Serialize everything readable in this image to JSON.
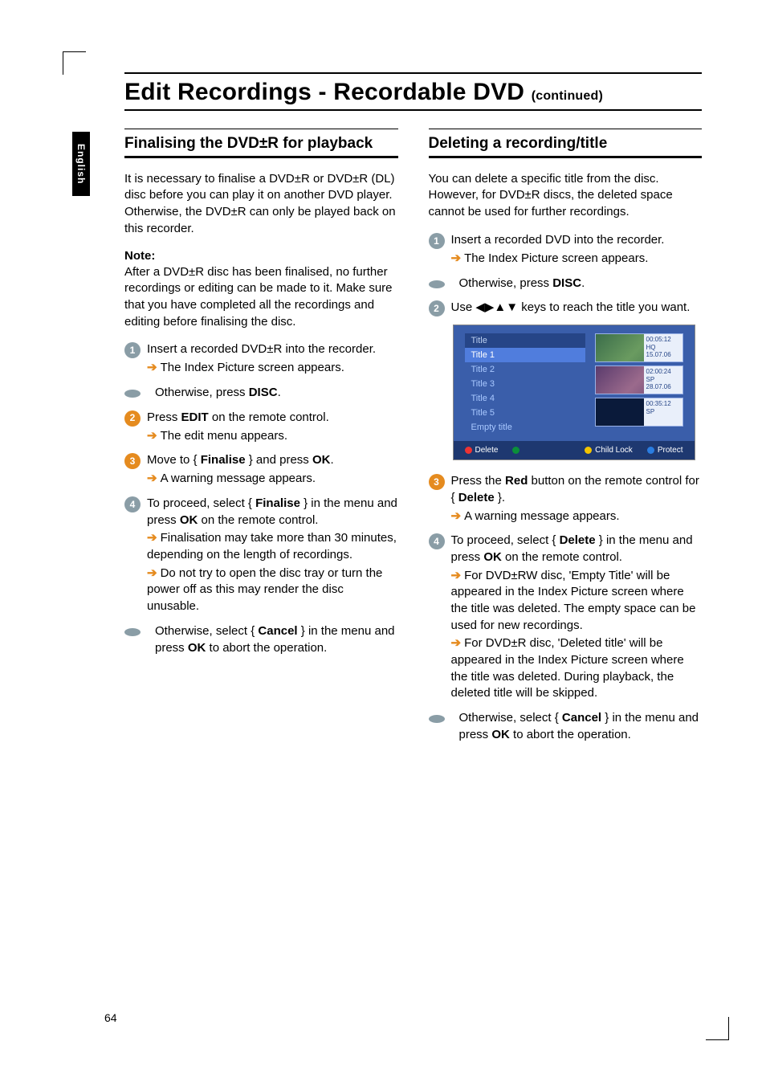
{
  "side_tab": "English",
  "main_title": "Edit Recordings - Recordable DVD",
  "main_title_cont": "(continued)",
  "left": {
    "heading": "Finalising the DVD±R for playback",
    "intro": "It is necessary to finalise a DVD±R or DVD±R (DL) disc before you can play it on another DVD player. Otherwise, the DVD±R can only be played back on this recorder.",
    "note_label": "Note:",
    "note_body": "After a DVD±R disc has been finalised, no further recordings or editing can be made to it. Make sure that you have completed all the recordings and editing before finalising the disc.",
    "step1": "Insert a recorded DVD±R into the recorder.",
    "step1_arrow": "The Index Picture screen appears.",
    "alt1_pre": "Otherwise, press ",
    "alt1_bold": "DISC",
    "alt1_post": ".",
    "step2_pre": "Press ",
    "step2_bold": "EDIT",
    "step2_post": " on the remote control.",
    "step2_arrow": "The edit menu appears.",
    "step3_pre": "Move to { ",
    "step3_bold": "Finalise",
    "step3_mid": " } and press ",
    "step3_bold2": "OK",
    "step3_post": ".",
    "step3_arrow": "A warning message appears.",
    "step4_pre": "To proceed, select { ",
    "step4_bold": "Finalise",
    "step4_mid": " } in the menu and press ",
    "step4_bold2": "OK",
    "step4_post": " on the remote control.",
    "step4_arrow1": "Finalisation may take more than 30 minutes, depending on the length of recordings.",
    "step4_arrow2": "Do not try to open the disc tray or turn the power off as this may render the disc unusable.",
    "alt2_pre": "Otherwise, select { ",
    "alt2_bold": "Cancel",
    "alt2_mid": " } in the menu and press ",
    "alt2_bold2": "OK",
    "alt2_post": " to abort the operation."
  },
  "right": {
    "heading": "Deleting a recording/title",
    "intro": "You can delete a specific title from the disc. However, for DVD±R discs, the deleted space cannot be used for further recordings.",
    "step1": "Insert a recorded DVD into the recorder.",
    "step1_arrow": "The Index Picture screen appears.",
    "alt1_pre": "Otherwise, press ",
    "alt1_bold": "DISC",
    "alt1_post": ".",
    "step2_pre": "Use ",
    "step2_keys": "◀▶▲▼",
    "step2_post": " keys to reach the title you want.",
    "step3_pre": "Press the ",
    "step3_bold": "Red",
    "step3_mid": " button on the remote control for { ",
    "step3_bold2": "Delete",
    "step3_post": " }.",
    "step3_arrow": "A warning message appears.",
    "step4_pre": "To proceed, select { ",
    "step4_bold": "Delete",
    "step4_mid": " } in the menu and press ",
    "step4_bold2": "OK",
    "step4_post": " on the remote control.",
    "step4_arrow1": "For DVD±RW disc, 'Empty Title' will be appeared in the Index Picture screen where the title was deleted. The empty space can be used for new recordings.",
    "step4_arrow2": "For DVD±R disc, 'Deleted title' will be appeared in the Index Picture screen where the title was deleted. During playback, the deleted title will be skipped.",
    "alt2_pre": "Otherwise, select { ",
    "alt2_bold": "Cancel",
    "alt2_mid": " } in the menu and press ",
    "alt2_bold2": "OK",
    "alt2_post": " to abort the operation."
  },
  "ipic": {
    "header": "Title",
    "rows": [
      "Title 1",
      "Title 2",
      "Title 3",
      "Title 4",
      "Title 5",
      "Empty title"
    ],
    "thumbs": [
      {
        "t1": "00:05:12",
        "t2": "HQ",
        "t3": "15.07.06"
      },
      {
        "t1": "02:00:24",
        "t2": "SP",
        "t3": "28.07.06"
      },
      {
        "t1": "00:35:12",
        "t2": "SP",
        "t3": ""
      }
    ],
    "foot_delete": "Delete",
    "foot_childlock": "Child Lock",
    "foot_protect": "Protect"
  },
  "page_number": "64"
}
